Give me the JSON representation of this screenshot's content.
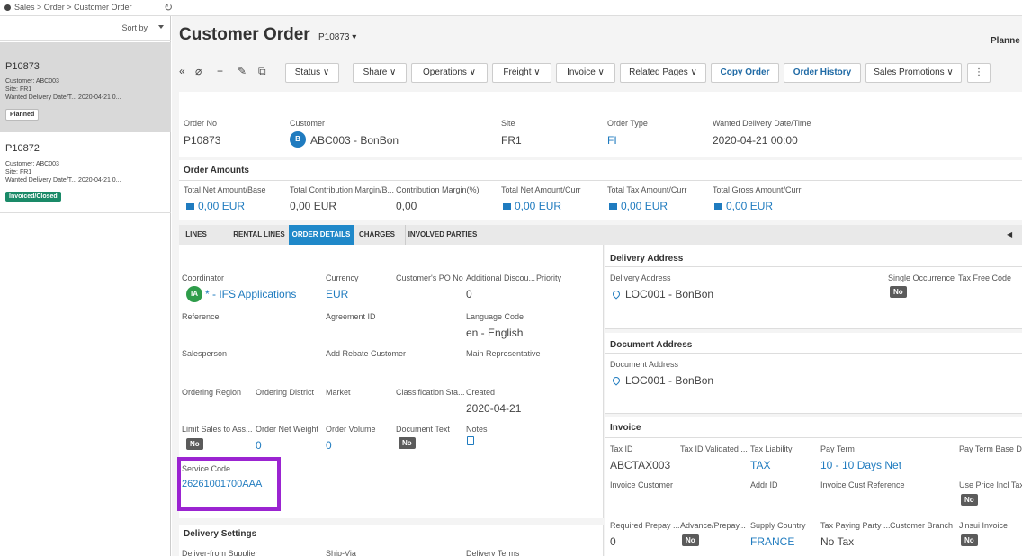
{
  "breadcrumb": "Sales > Order > Customer Order",
  "sidebar": {
    "sort_label": "Sort by",
    "orders": [
      {
        "id": "P10873",
        "customer": "Customer:  ABC003",
        "site": "Site:  FR1",
        "wanted": "Wanted Delivery Date/T...  2020-04-21 0...",
        "status": "Planned"
      },
      {
        "id": "P10872",
        "customer": "Customer:  ABC003",
        "site": "Site:  FR1",
        "wanted": "Wanted Delivery Date/T...  2020-04-21 0...",
        "status": "Invoiced/Closed"
      }
    ]
  },
  "header": {
    "title": "Customer Order",
    "order_id": "P10873 ▾",
    "status": "Planne",
    "toolbar": {
      "status": "Status ∨",
      "share": "Share ∨",
      "operations": "Operations ∨",
      "freight": "Freight ∨",
      "invoice": "Invoice ∨",
      "related": "Related Pages ∨",
      "copy": "Copy Order",
      "history": "Order History",
      "promotions": "Sales Promotions ∨",
      "more": "⋮"
    }
  },
  "summary": {
    "order_no_label": "Order No",
    "order_no": "P10873",
    "customer_label": "Customer",
    "customer_avatar": "B",
    "customer": "ABC003 - BonBon",
    "site_label": "Site",
    "site": "FR1",
    "order_type_label": "Order Type",
    "order_type": "FI",
    "wanted_label": "Wanted Delivery Date/Time",
    "wanted": "2020-04-21 00:00"
  },
  "amounts": {
    "title": "Order Amounts",
    "net_base_label": "Total Net Amount/Base",
    "net_base": "0,00 EUR",
    "contrib_label": "Total Contribution Margin/B...",
    "contrib": "0,00 EUR",
    "contrib_pct_label": "Contribution Margin(%)",
    "contrib_pct": "0,00",
    "net_curr_label": "Total Net Amount/Curr",
    "net_curr": "0,00 EUR",
    "tax_label": "Total Tax Amount/Curr",
    "tax": "0,00 EUR",
    "gross_label": "Total Gross Amount/Curr",
    "gross": "0,00 EUR"
  },
  "tabs": [
    "LINES",
    "RENTAL LINES",
    "ORDER DETAILS",
    "CHARGES",
    "INVOLVED PARTIES"
  ],
  "details": {
    "coordinator_label": "Coordinator",
    "coordinator_avatar": "IA",
    "coordinator": "* - IFS Applications",
    "currency_label": "Currency",
    "currency": "EUR",
    "po_label": "Customer's PO No",
    "discount_label": "Additional Discou...",
    "discount": "0",
    "priority_label": "Priority",
    "reference_label": "Reference",
    "agreement_label": "Agreement ID",
    "language_label": "Language Code",
    "language": "en - English",
    "salesperson_label": "Salesperson",
    "rebate_label": "Add Rebate Customer",
    "main_rep_label": "Main Representative",
    "region_label": "Ordering Region",
    "district_label": "Ordering District",
    "market_label": "Market",
    "classification_label": "Classification Sta...",
    "created_label": "Created",
    "created": "2020-04-21",
    "limit_label": "Limit Sales to Ass...",
    "limit": "No",
    "net_weight_label": "Order Net Weight",
    "net_weight": "0",
    "volume_label": "Order Volume",
    "volume": "0",
    "doc_text_label": "Document Text",
    "doc_text": "No",
    "notes_label": "Notes",
    "service_code_label": "Service Code",
    "service_code": "26261001700AAA",
    "delivery_settings": "Delivery Settings",
    "deliver_from_label": "Deliver-from Supplier",
    "ship_via_label": "Ship-Via",
    "delivery_terms_label": "Delivery Terms"
  },
  "delivery_address": {
    "title": "Delivery Address",
    "label": "Delivery Address",
    "value": "LOC001 - BonBon",
    "single_label": "Single Occurrence",
    "single": "No",
    "tax_free_label": "Tax Free Code"
  },
  "document_address": {
    "title": "Document Address",
    "label": "Document Address",
    "value": "LOC001 - BonBon"
  },
  "invoice": {
    "title": "Invoice",
    "tax_id_label": "Tax ID",
    "tax_id": "ABCTAX003",
    "tax_validated_label": "Tax ID Validated ...",
    "tax_liability_label": "Tax Liability",
    "tax_liability": "TAX",
    "pay_term_label": "Pay Term",
    "pay_term": "10 - 10 Days Net",
    "pay_term_base_label": "Pay Term Base D...",
    "inv_customer_label": "Invoice Customer",
    "addr_id_label": "Addr ID",
    "cust_ref_label": "Invoice Cust Reference",
    "price_incl_label": "Use Price Incl Tax",
    "price_incl": "No",
    "prepay_label": "Required Prepay ...",
    "prepay": "0",
    "adv_prepay_label": "Advance/Prepay...",
    "adv_prepay": "No",
    "supply_country_label": "Supply Country",
    "supply_country": "FRANCE",
    "tax_party_label": "Tax Paying Party ...",
    "tax_party": "No Tax",
    "branch_label": "Customer Branch",
    "jinsui_label": "Jinsui Invoice",
    "jinsui": "No"
  }
}
